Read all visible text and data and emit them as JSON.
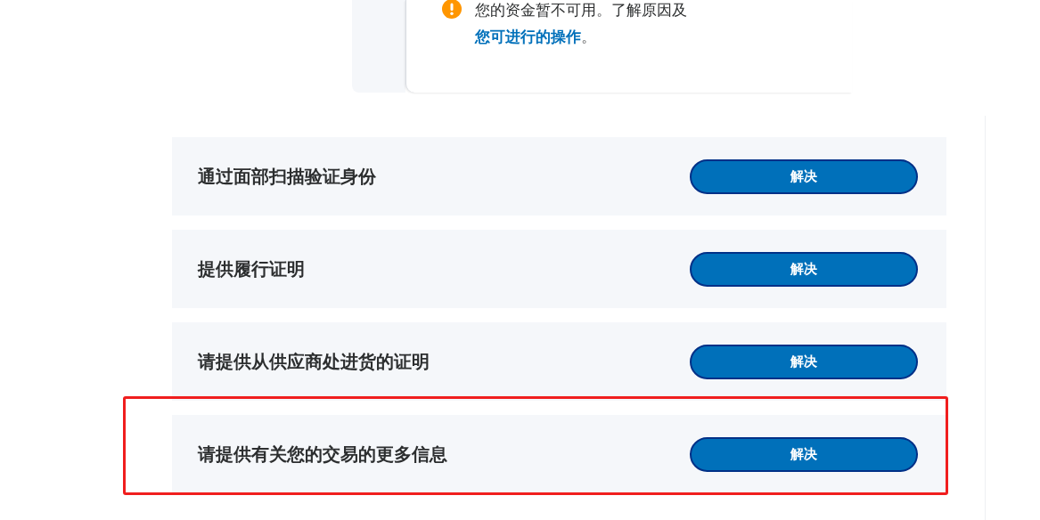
{
  "notice": {
    "kind": "warning",
    "text_before": "您的资金暂不可用。了解原因及",
    "link": "您可进行的操作",
    "text_after": "。"
  },
  "tasks": [
    {
      "title": "通过面部扫描验证身份",
      "button": "解决",
      "highlighted": false
    },
    {
      "title": "提供履行证明",
      "button": "解决",
      "highlighted": false
    },
    {
      "title": "请提供从供应商处进货的证明",
      "button": "解决",
      "highlighted": false
    },
    {
      "title": "请提供有关您的交易的更多信息",
      "button": "解决",
      "highlighted": true
    }
  ]
}
